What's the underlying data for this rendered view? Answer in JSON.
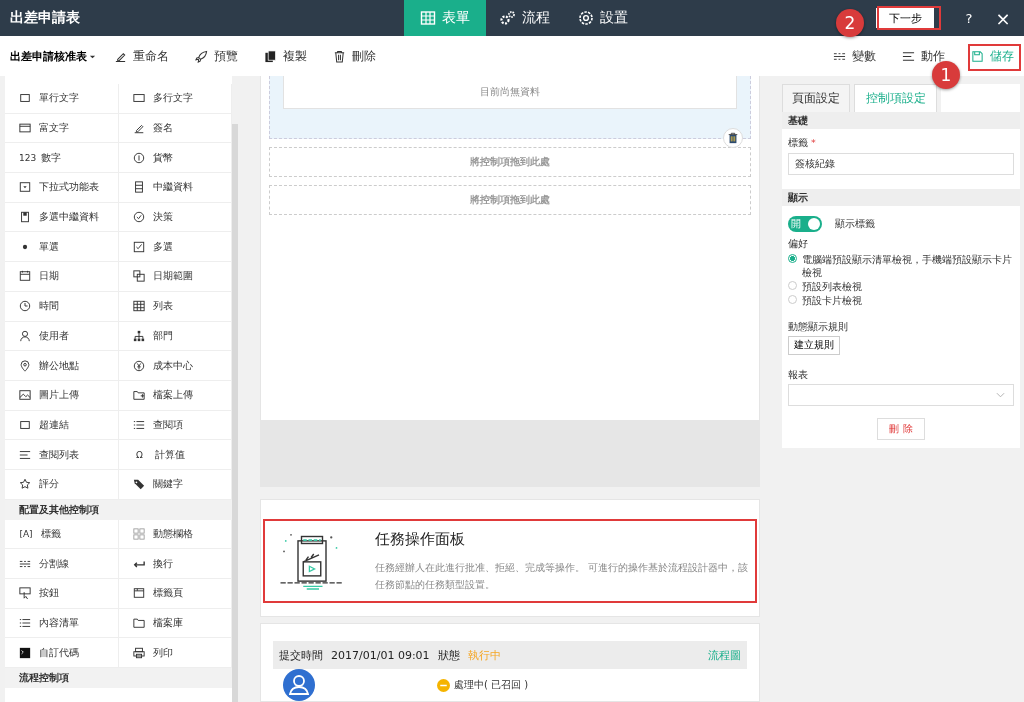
{
  "header": {
    "title": "出差申請表",
    "tabs": [
      {
        "label": "表單",
        "selected": true
      },
      {
        "label": "流程",
        "selected": false
      },
      {
        "label": "設置",
        "selected": false
      }
    ],
    "next_button": "下一步",
    "help": "?",
    "close": "×"
  },
  "callouts": [
    {
      "number": "2"
    },
    {
      "number": "1"
    }
  ],
  "toolbar": {
    "form_select": "出差申請核准表",
    "actions": [
      "重命名",
      "預覽",
      "複製",
      "刪除"
    ],
    "right_actions": [
      {
        "label": "變數",
        "highlighted": false
      },
      {
        "label": "動作",
        "highlighted": false
      },
      {
        "label": "儲存",
        "highlighted": true
      }
    ]
  },
  "palette": {
    "groups": [
      {
        "items": [
          "單行文字",
          "多行文字",
          "富文字",
          "簽名",
          {
            "label": "數字",
            "icon_text": "123"
          },
          "貨幣",
          "下拉式功能表",
          "中繼資料",
          "多選中繼資料",
          "決策",
          "單選",
          "多選",
          "日期",
          "日期範圍",
          "時間",
          "列表",
          "使用者",
          "部門",
          "辦公地點",
          "成本中心",
          "圖片上傳",
          "檔案上傳",
          "超連結",
          "查閱項",
          "查閱列表",
          {
            "label": "計算值",
            "icon_text": "Ω"
          },
          "評分",
          "關鍵字"
        ]
      },
      {
        "title": "配置及其他控制項",
        "items": [
          {
            "label": "標籤",
            "icon_text": "[A]"
          },
          "動態欄格",
          "分割線",
          "換行",
          "按鈕",
          "標籤頁",
          "內容清單",
          "檔案庫",
          "自訂代碼",
          "列印"
        ]
      },
      {
        "title": "流程控制項"
      }
    ]
  },
  "canvas": {
    "empty_text": "目前尚無資料",
    "drop_zones": [
      "將控制項拖到此處",
      "將控制項拖到此處"
    ],
    "task_panel": {
      "title": "任務操作面板",
      "description": "任務經辦人在此進行批准、拒絕、完成等操作。 可進行的操作基於流程設計器中，該任務節點的任務類型設置。",
      "highlighted": true
    },
    "record": {
      "submit_label": "提交時間",
      "submit_time": "2017/01/01 09:01",
      "status_label": "狀態",
      "status": "執行中",
      "link": "流程圖",
      "step_status": "處理中( 已召回 )"
    }
  },
  "settings": {
    "tabs": [
      {
        "label": "頁面設定",
        "selected": false
      },
      {
        "label": "控制項設定",
        "selected": true
      }
    ],
    "basic": {
      "title": "基礎",
      "label_title": "標籤",
      "required_mark": "*",
      "label_value": "簽核紀錄"
    },
    "display": {
      "title": "顯示",
      "toggle": {
        "on": true,
        "text": "開",
        "label": "顯示標籤"
      },
      "preference_title": "偏好",
      "options": [
        {
          "label": "電腦端預設顯示清單檢視，手機端預設顯示卡片檢視",
          "selected": true
        },
        {
          "label": "預設列表檢視",
          "selected": false
        },
        {
          "label": "預設卡片檢視",
          "selected": false
        }
      ],
      "rule_title": "動態顯示規則",
      "rule_button": "建立規則",
      "report_title": "報表",
      "delete_button": "刪 除"
    }
  }
}
